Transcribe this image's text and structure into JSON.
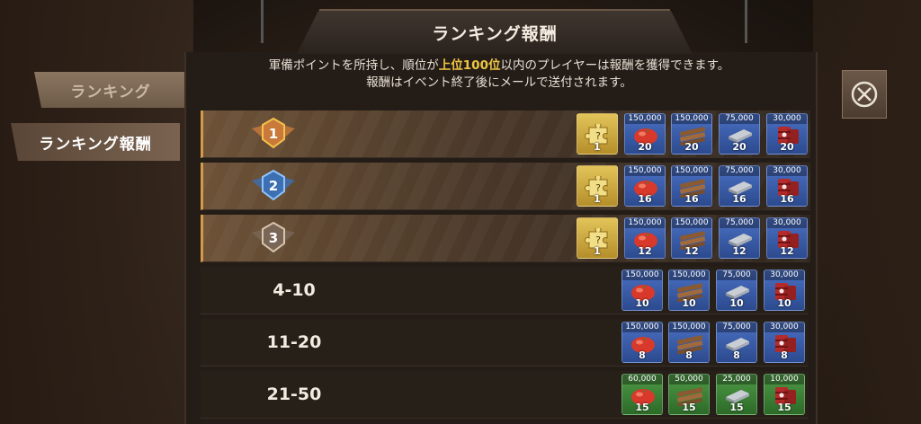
{
  "header": {
    "title": "ランキング報酬"
  },
  "description": {
    "line1_before": "軍備ポイントを所持し、順位が",
    "line1_highlight": "上位100位",
    "line1_after": "以内のプレイヤーは報酬を獲得できます。",
    "line2": "報酬はイベント終了後にメールで送付されます。"
  },
  "tabs": [
    {
      "label": "ランキング"
    },
    {
      "label": "ランキング報酬"
    }
  ],
  "rows": [
    {
      "rank": "1",
      "puzzle": "1",
      "amounts": [
        "150,000",
        "150,000",
        "75,000",
        "30,000"
      ],
      "counts": [
        "20",
        "20",
        "20",
        "20"
      ]
    },
    {
      "rank": "2",
      "puzzle": "1",
      "amounts": [
        "150,000",
        "150,000",
        "75,000",
        "30,000"
      ],
      "counts": [
        "16",
        "16",
        "16",
        "16"
      ]
    },
    {
      "rank": "3",
      "puzzle": "1",
      "amounts": [
        "150,000",
        "150,000",
        "75,000",
        "30,000"
      ],
      "counts": [
        "12",
        "12",
        "12",
        "12"
      ]
    },
    {
      "rank": "4-10",
      "amounts": [
        "150,000",
        "150,000",
        "75,000",
        "30,000"
      ],
      "counts": [
        "10",
        "10",
        "10",
        "10"
      ]
    },
    {
      "rank": "11-20",
      "amounts": [
        "150,000",
        "150,000",
        "75,000",
        "30,000"
      ],
      "counts": [
        "8",
        "8",
        "8",
        "8"
      ]
    },
    {
      "rank": "21-50",
      "amounts": [
        "60,000",
        "50,000",
        "25,000",
        "10,000"
      ],
      "counts": [
        "15",
        "15",
        "15",
        "15"
      ]
    }
  ],
  "icons": [
    "tomato-icon",
    "wood-icon",
    "steel-icon",
    "fuel-barrel-icon",
    "puzzle-icon",
    "close-icon",
    "medal-icon"
  ],
  "colors": {
    "highlight": "#f0c545",
    "blue_frame": "#3a5faf",
    "green_frame": "#3e8a38",
    "gold_frame": "#d4b04a"
  }
}
